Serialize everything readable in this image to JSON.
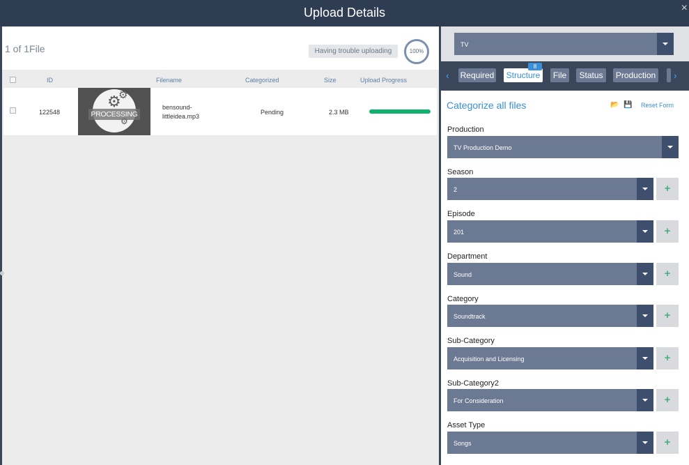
{
  "window": {
    "title": "Upload Details"
  },
  "left": {
    "file_count": "1 of 1File",
    "trouble_button": "Having trouble uploading",
    "overall_progress": "100%",
    "columns": [
      "ID",
      "Filename",
      "Categorized",
      "Size",
      "Upload Progress"
    ],
    "rows": [
      {
        "id": "122548",
        "thumbnail_label": "PROCESSING",
        "filename_line1": "bensound-",
        "filename_line2": "littleidea.mp3",
        "categorized": "Pending",
        "size": "2.3 MB",
        "progress": 1.0
      }
    ]
  },
  "right": {
    "type_select": "TV",
    "tabs": [
      "Required",
      "Structure",
      "File",
      "Status",
      "Production"
    ],
    "active_tab": "Structure",
    "structure_badge": "8",
    "form_title": "Categorize all files",
    "reset_label": "Reset Form",
    "fields": [
      {
        "label": "Production",
        "value": "TV Production Demo"
      },
      {
        "label": "Season",
        "value": "2"
      },
      {
        "label": "Episode",
        "value": "201"
      },
      {
        "label": "Department",
        "value": "Sound"
      },
      {
        "label": "Category",
        "value": "Soundtrack"
      },
      {
        "label": "Sub-Category",
        "value": "Acquisition and Licensing"
      },
      {
        "label": "Sub-Category2",
        "value": "For Consideration"
      },
      {
        "label": "Asset Type",
        "value": "Songs"
      }
    ],
    "add_glyph": "+"
  },
  "colors": {
    "accent": "#3a8fd6",
    "dropdown": "#6b7a92",
    "dropdown_caret": "#3d4f6c",
    "progress": "#11b26f",
    "titlebar": "#2f3d52"
  },
  "icons": [
    "close-icon",
    "chevron-left-icon",
    "chevron-right-icon",
    "folder-open-icon",
    "save-icon",
    "gear-icon",
    "plus-icon"
  ]
}
